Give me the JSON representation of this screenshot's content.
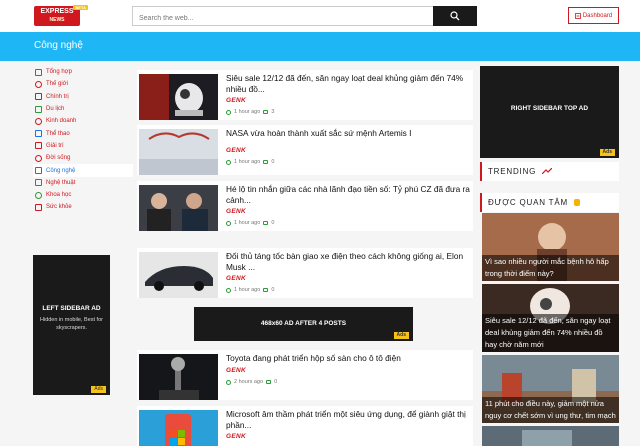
{
  "header": {
    "logo_text": "EXPRESS",
    "logo_sub": "NEWS",
    "logo_badge": "BETA",
    "search_placeholder": "Search the web...",
    "dashboard_label": "Dashboard"
  },
  "category": {
    "title": "Công nghệ"
  },
  "sidebar": {
    "items": [
      {
        "label": "Tổng hợp",
        "icon": "grid-icon"
      },
      {
        "label": "Thế giới",
        "icon": "globe-icon"
      },
      {
        "label": "Chính trị",
        "icon": "flag-icon"
      },
      {
        "label": "Du lịch",
        "icon": "plane-icon"
      },
      {
        "label": "Kinh doanh",
        "icon": "briefcase-icon"
      },
      {
        "label": "Thể thao",
        "icon": "ball-icon"
      },
      {
        "label": "Giải trí",
        "icon": "film-icon"
      },
      {
        "label": "Đời sống",
        "icon": "heart-icon"
      },
      {
        "label": "Công nghệ",
        "icon": "monitor-icon",
        "active": true
      },
      {
        "label": "Nghệ thuật",
        "icon": "palette-icon"
      },
      {
        "label": "Khoa học",
        "icon": "flask-icon"
      },
      {
        "label": "Sức khỏe",
        "icon": "health-icon"
      }
    ],
    "ad": {
      "title": "LEFT SIDEBAR AD",
      "desc": "Hidden in mobile, Best for skyscrapers.",
      "tag": "Ads"
    }
  },
  "articles": [
    {
      "title": "Siêu sale 12/12 đã đến, săn ngay loạt deal khủng giảm đến 74% nhiều đồ...",
      "source": "GENK",
      "time": "1 hour ago",
      "comments": "3",
      "thumb": "projector"
    },
    {
      "title": "NASA vừa hoàn thành xuất sắc sứ mệnh Artemis I",
      "source": "GENK",
      "time": "1 hour ago",
      "comments": "0",
      "thumb": "capsule"
    },
    {
      "title": "Hé lộ tin nhắn giữa các nhà lãnh đạo tiền số: Tỷ phú CZ đã đưa ra cảnh...",
      "source": "GENK",
      "time": "1 hour ago",
      "comments": "0",
      "thumb": "people"
    },
    {
      "title": "Đối thủ táng tốc bàn giao xe điện theo cách không giống ai, Elon Musk ...",
      "source": "GENK",
      "time": "1 hour ago",
      "comments": "0",
      "thumb": "car"
    },
    {
      "title": "Toyota đang phát triển hộp số sàn cho ô tô điện",
      "source": "GENK",
      "time": "2 hours ago",
      "comments": "0",
      "thumb": "gearstick"
    },
    {
      "title": "Microsoft âm thầm phát triển một siêu ứng dụng, để giành giật thị phần...",
      "source": "GENK",
      "time": "",
      "comments": "",
      "thumb": "phone"
    }
  ],
  "mid_ad": {
    "title": "468x60 AD AFTER 4 POSTS",
    "tag": "Ads"
  },
  "right": {
    "ad": {
      "title": "RIGHT SIDEBAR TOP AD",
      "tag": "Ads"
    },
    "trending_label": "TRENDING",
    "popular_label": "ĐƯỢC QUAN TÂM",
    "popular": [
      {
        "caption": "Vì sao nhiều người mắc bệnh hô hấp trong thời điểm này?"
      },
      {
        "caption": "Siêu sale 12/12 đã đến, săn ngay loạt deal khủng giảm đến 74% nhiều đồ hay chờ năm mới"
      },
      {
        "caption": "11 phút cho điều này, giảm một nửa nguy cơ chết sớm vì ung thư, tim mạch"
      }
    ]
  },
  "colors": {
    "accent": "#1fb6f5",
    "brand_red": "#d0181f",
    "ad_bg": "#1a1a1a"
  }
}
